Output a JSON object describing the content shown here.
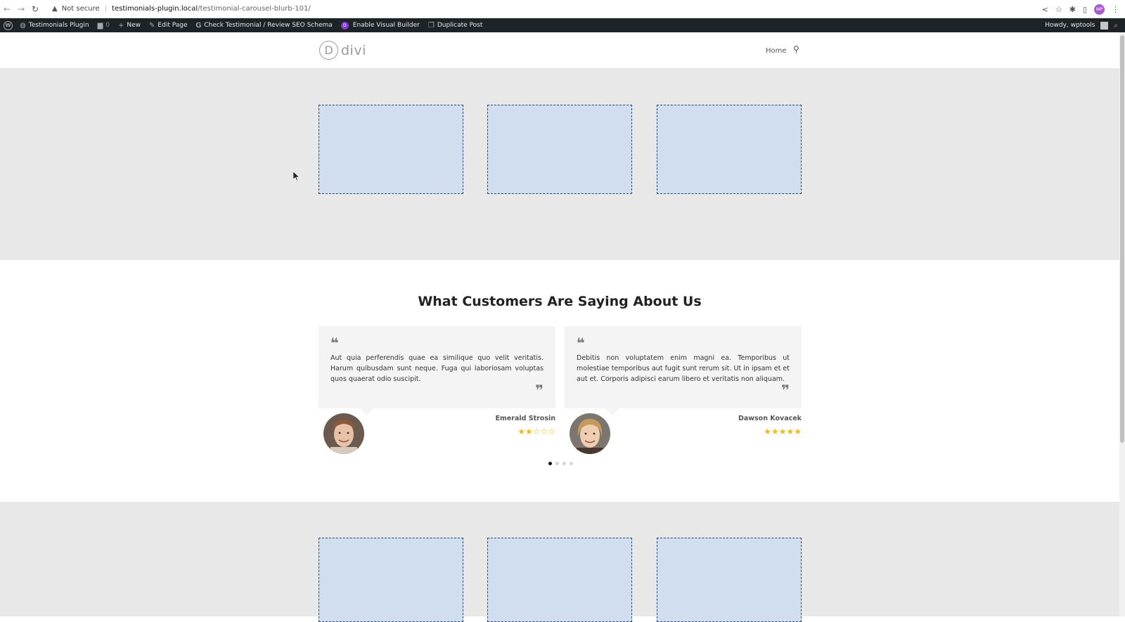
{
  "browser": {
    "security_label": "Not secure",
    "url_host": "testimonials-plugin.local",
    "url_path": "/testimonial-carousel-blurb-101/",
    "avatar_initials": "WP"
  },
  "adminbar": {
    "site_name": "Testimonials Plugin",
    "comments_count": "0",
    "new_label": "New",
    "edit_page_label": "Edit Page",
    "seo_check_label": "Check Testimonial / Review SEO Schema",
    "visual_builder_label": "Enable Visual Builder",
    "duplicate_label": "Duplicate Post",
    "greeting": "Howdy, wptools"
  },
  "header": {
    "logo_letter": "D",
    "logo_text": "divi",
    "menu": [
      {
        "label": "Home"
      }
    ]
  },
  "testimonials": {
    "heading": "What Customers Are Saying About Us",
    "items": [
      {
        "text": "Aut quia perferendis quae ea similique quo velit veritatis. Harum quibusdam sunt neque. Fuga qui laboriosam voluptas quos quaerat odio suscipit.",
        "name": "Emerald Strosin",
        "rating": 2,
        "rating_stars": "★★☆☆☆"
      },
      {
        "text": "Debitis non voluptatem enim magni ea. Temporibus ut molestiae temporibus aut fugit sunt rerum sit. Ut in ipsam et et aut et. Corporis adipisci earum libero et veritatis non aliquam.",
        "name": "Dawson Kovacek",
        "rating": 5,
        "rating_stars": "★★★★★"
      }
    ],
    "pagination": {
      "total": 4,
      "active": 1
    }
  },
  "colors": {
    "admin_bar": "#1d2327",
    "placeholder_fill": "#d1deef",
    "placeholder_border": "#2b4770",
    "section_gray": "#e8e8e8",
    "star": "#f0b81b"
  }
}
